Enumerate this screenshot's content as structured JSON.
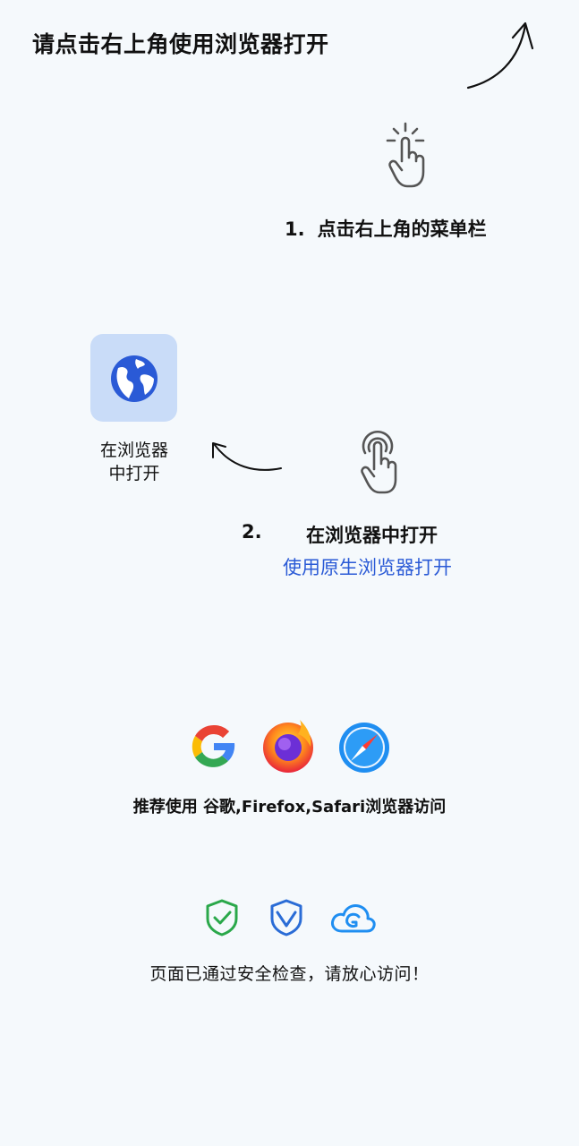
{
  "header": {
    "title": "请点击右上角使用浏览器打开"
  },
  "step1": {
    "number": "1.",
    "text": "点击右上角的菜单栏"
  },
  "open_in_browser_tile": {
    "icon": "globe-icon",
    "label_line1": "在浏览器",
    "label_line2": "中打开"
  },
  "step2": {
    "number": "2.",
    "title": "在浏览器中打开",
    "subtitle": "使用原生浏览器打开"
  },
  "browsers": {
    "icons": [
      "google-icon",
      "firefox-icon",
      "safari-icon"
    ],
    "recommend_text": "推荐使用 谷歌,Firefox,Safari浏览器访问"
  },
  "security": {
    "icons": [
      "shield-check-icon",
      "shield-v-icon",
      "cloud-security-icon"
    ],
    "text": "页面已通过安全检查，请放心访问！"
  },
  "colors": {
    "background": "#f5f9fc",
    "accent": "#2a5ad6",
    "tile": "#c9dcf8"
  }
}
